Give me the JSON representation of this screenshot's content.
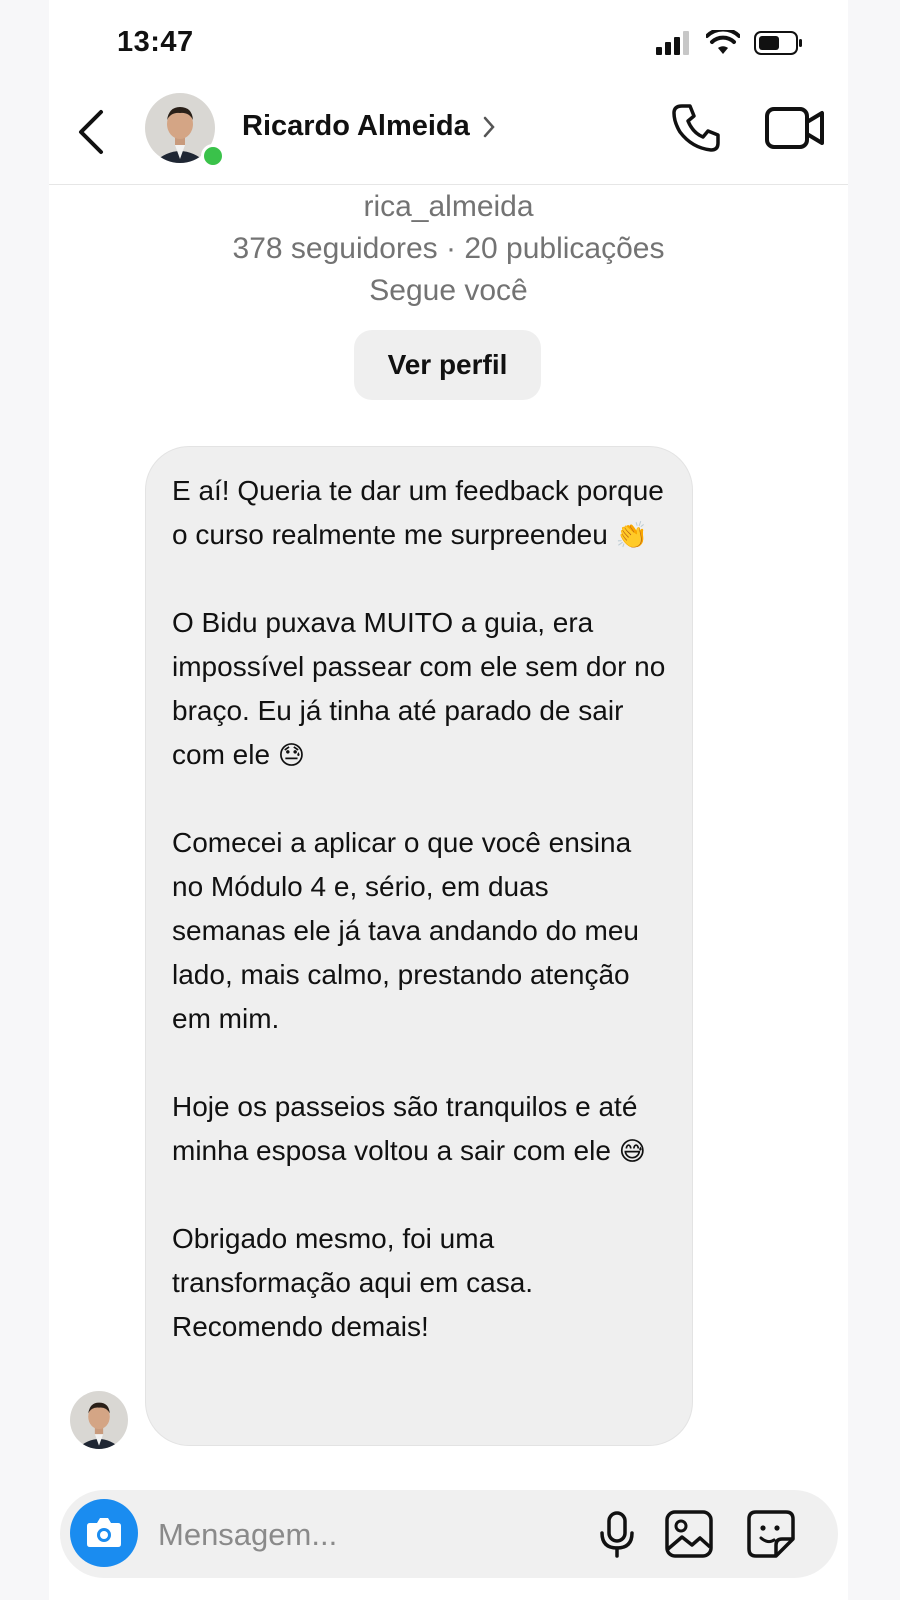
{
  "status_bar": {
    "time": "13:47"
  },
  "header": {
    "name": "Ricardo Almeida"
  },
  "profile": {
    "username": "rica_almeida",
    "stats": "378 seguidores · 20 publicações",
    "follow_status": "Segue você",
    "view_profile_label": "Ver perfil"
  },
  "message": {
    "paragraphs": [
      {
        "text": "E aí! Queria te dar um feedback porque o curso realmente me surpreendeu",
        "emoji": "👏"
      },
      {
        "text": "O Bidu puxava MUITO a guia, era impossível passear com ele sem dor no braço. Eu já tinha até parado de sair com ele",
        "emoji": "😓"
      },
      {
        "text": "Comecei a aplicar o que você ensina no Módulo 4 e, sério, em duas semanas ele já tava andando do meu lado, mais calmo, prestando atenção em mim.",
        "emoji": ""
      },
      {
        "text": "Hoje os passeios são tranquilos e até minha esposa voltou a sair com ele",
        "emoji": "😅"
      },
      {
        "text": "Obrigado mesmo, foi uma transformação aqui em casa. Recomendo demais!",
        "emoji": ""
      }
    ]
  },
  "composer": {
    "placeholder": "Mensagem..."
  },
  "icons": {
    "camera": "camera-icon",
    "mic": "microphone-icon",
    "gallery": "image-icon",
    "sticker": "sticker-icon"
  },
  "colors": {
    "accent": "#1a8cf0",
    "online": "#3ac24a",
    "bubble": "#efefef"
  }
}
